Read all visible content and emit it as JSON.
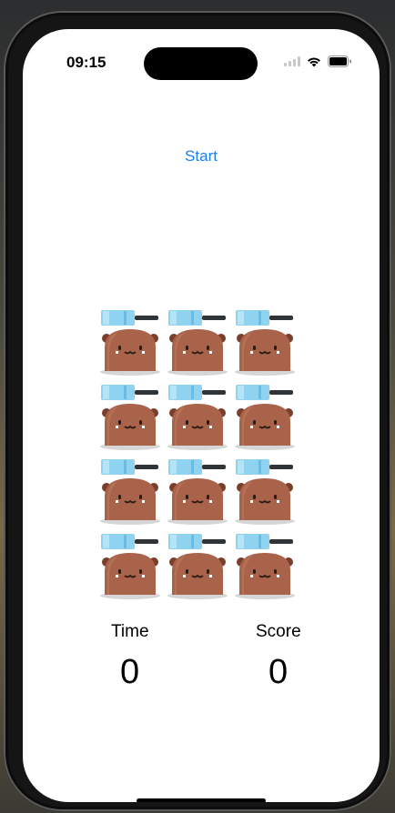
{
  "status_bar": {
    "time": "09:15",
    "icons": [
      "signal-icon",
      "wifi-icon",
      "battery-icon"
    ]
  },
  "start_label": "Start",
  "grid": {
    "rows": 4,
    "cols": 3,
    "cell_icons": [
      "hammer-icon",
      "mole-icon"
    ]
  },
  "time": {
    "label": "Time",
    "value": "0"
  },
  "score": {
    "label": "Score",
    "value": "0"
  },
  "colors": {
    "accent": "#1a7ff0",
    "mole": "#a9634a",
    "hammer": "#8fd3f0"
  }
}
